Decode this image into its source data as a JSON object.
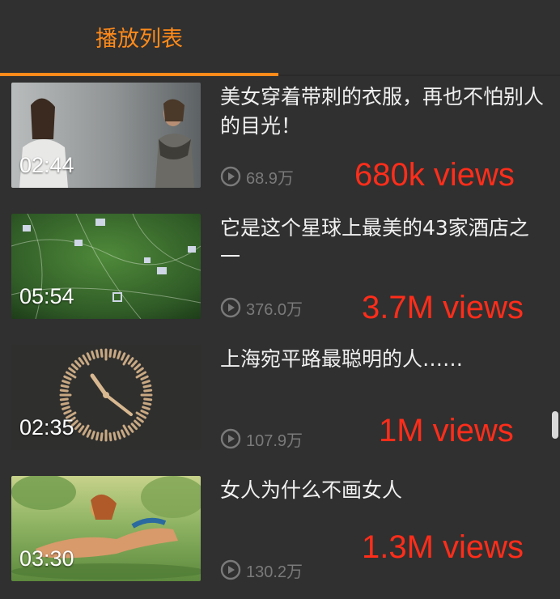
{
  "header": {
    "tab_label": "播放列表"
  },
  "items": [
    {
      "title": "美女穿着带刺的衣服，再也不怕别人的目光！",
      "duration": "02:44",
      "views": "68.9万",
      "annotation": "680k views",
      "thumbnail": "two-people-facing"
    },
    {
      "title": "它是这个星球上最美的43家酒店之一",
      "duration": "05:54",
      "views": "376.0万",
      "annotation": "3.7M views",
      "thumbnail": "green-map-aerial"
    },
    {
      "title": "上海宛平路最聪明的人……",
      "duration": "02:35",
      "views": "107.9万",
      "annotation": "1M views",
      "thumbnail": "clock-figures"
    },
    {
      "title": "女人为什么不画女人",
      "duration": "03:30",
      "views": "130.2万",
      "annotation": "1.3M views",
      "thumbnail": "painting-reclining-figure"
    }
  ],
  "colors": {
    "accent": "#ff8a1a",
    "annotation": "#ff2d1a",
    "background": "#303030"
  }
}
